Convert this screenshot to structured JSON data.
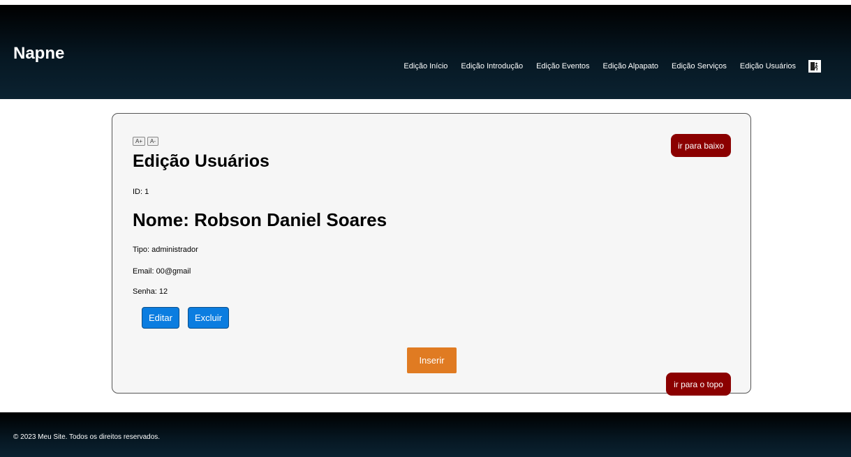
{
  "header": {
    "brand": "Napne",
    "nav": [
      {
        "label": "Edição Início"
      },
      {
        "label": "Edição Introdução"
      },
      {
        "label": "Edição Eventos"
      },
      {
        "label": "Edição Alpapato"
      },
      {
        "label": "Edição Serviços"
      },
      {
        "label": "Edição Usuários"
      }
    ],
    "exit_icon": "exit-door-icon"
  },
  "main": {
    "font_increase": "A+",
    "font_decrease": "A-",
    "title": "Edição Usuários",
    "scroll_down": "ir para baixo",
    "scroll_top": "ir para o topo",
    "user": {
      "id": "ID: 1",
      "nome": "Nome: Robson Daniel Soares",
      "tipo": "Tipo: administrador",
      "email": "Email: 00@gmail",
      "senha": "Senha: 12"
    },
    "edit_label": "Editar",
    "delete_label": "Excluir",
    "insert_label": "Inserir"
  },
  "footer": {
    "text": "© 2023 Meu Site. Todos os direitos reservados."
  },
  "colors": {
    "header_bg": "#04121b",
    "blue_button": "#0b7de0",
    "insert_button": "#e07b22",
    "scroll_button": "#8b0000"
  }
}
